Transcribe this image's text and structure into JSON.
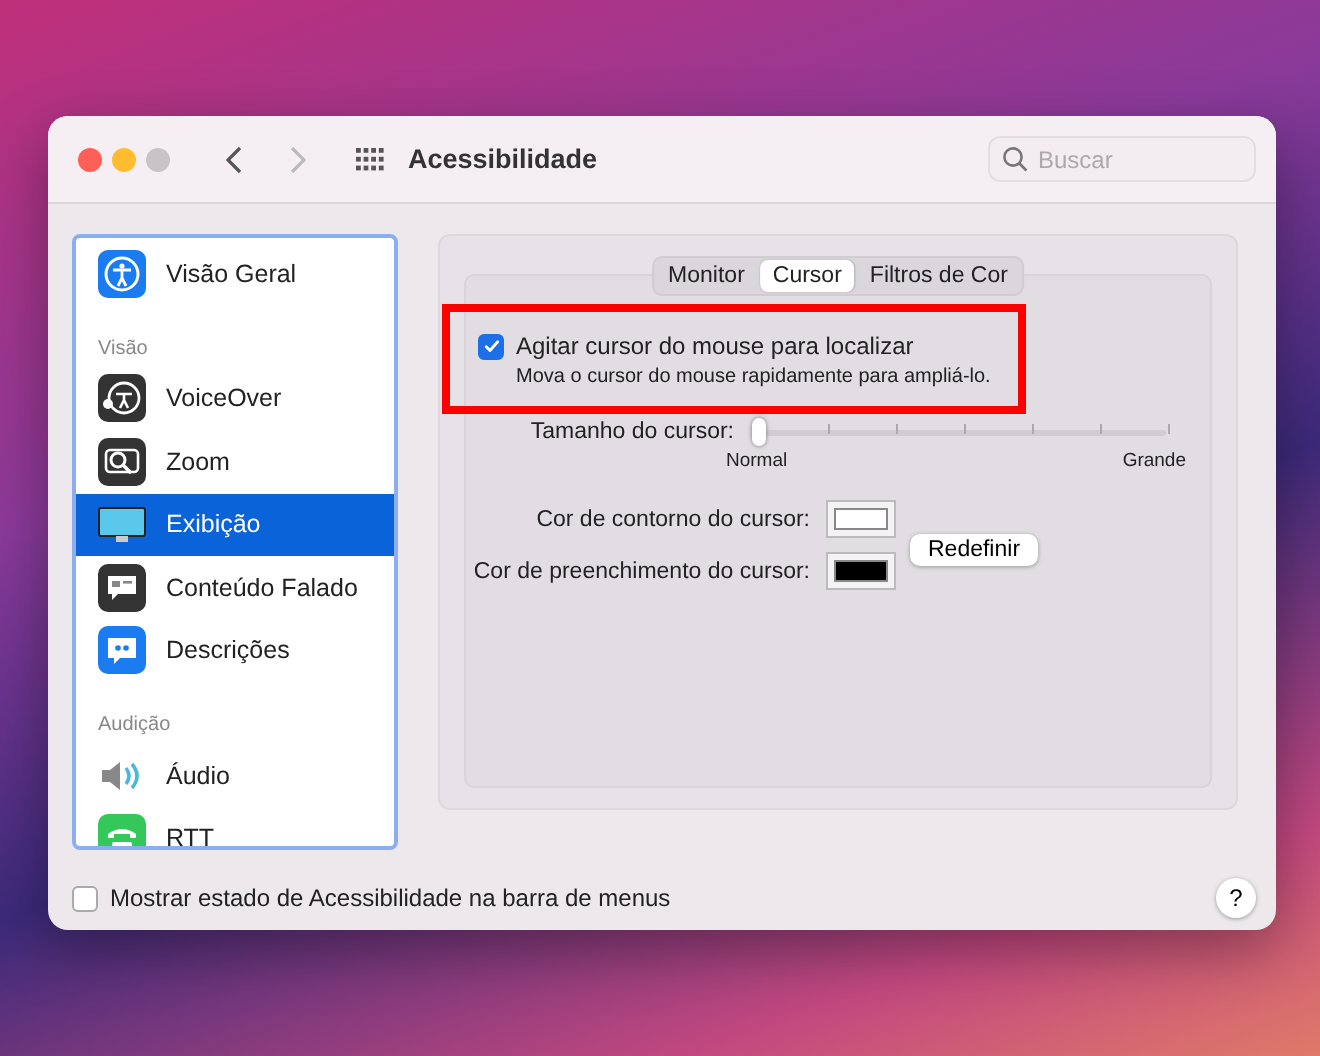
{
  "window": {
    "title": "Acessibilidade",
    "search": {
      "placeholder": "Buscar"
    }
  },
  "sidebar": {
    "items": [
      {
        "kind": "item",
        "label": "Visão Geral",
        "selected": false
      },
      {
        "kind": "section",
        "label": "Visão"
      },
      {
        "kind": "item",
        "label": "VoiceOver",
        "selected": false
      },
      {
        "kind": "item",
        "label": "Zoom",
        "selected": false
      },
      {
        "kind": "item",
        "label": "Exibição",
        "selected": true
      },
      {
        "kind": "item",
        "label": "Conteúdo Falado",
        "selected": false
      },
      {
        "kind": "item",
        "label": "Descrições",
        "selected": false
      },
      {
        "kind": "section",
        "label": "Audição"
      },
      {
        "kind": "item",
        "label": "Áudio",
        "selected": false
      },
      {
        "kind": "item",
        "label": "RTT",
        "selected": false
      }
    ]
  },
  "tabs": [
    {
      "label": "Monitor",
      "selected": false
    },
    {
      "label": "Cursor",
      "selected": true
    },
    {
      "label": "Filtros de Cor",
      "selected": false
    }
  ],
  "shake_option": {
    "label": "Agitar cursor do mouse para localizar",
    "description": "Mova o cursor do mouse rapidamente para ampliá-lo.",
    "checked": true,
    "highlighted": true
  },
  "cursor_size": {
    "label": "Tamanho do cursor:",
    "level": 0,
    "min_label": "Normal",
    "max_label": "Grande"
  },
  "color_wells": [
    {
      "label": "Cor de contorno do cursor:",
      "color": "#ffffff"
    },
    {
      "label": "Cor de preenchimento do cursor:",
      "color": "#000000"
    }
  ],
  "reset_button": "Redefinir",
  "menu_bar_option": {
    "label": "Mostrar estado de Acessibilidade na barra de menus",
    "checked": false
  },
  "help_button": "?"
}
